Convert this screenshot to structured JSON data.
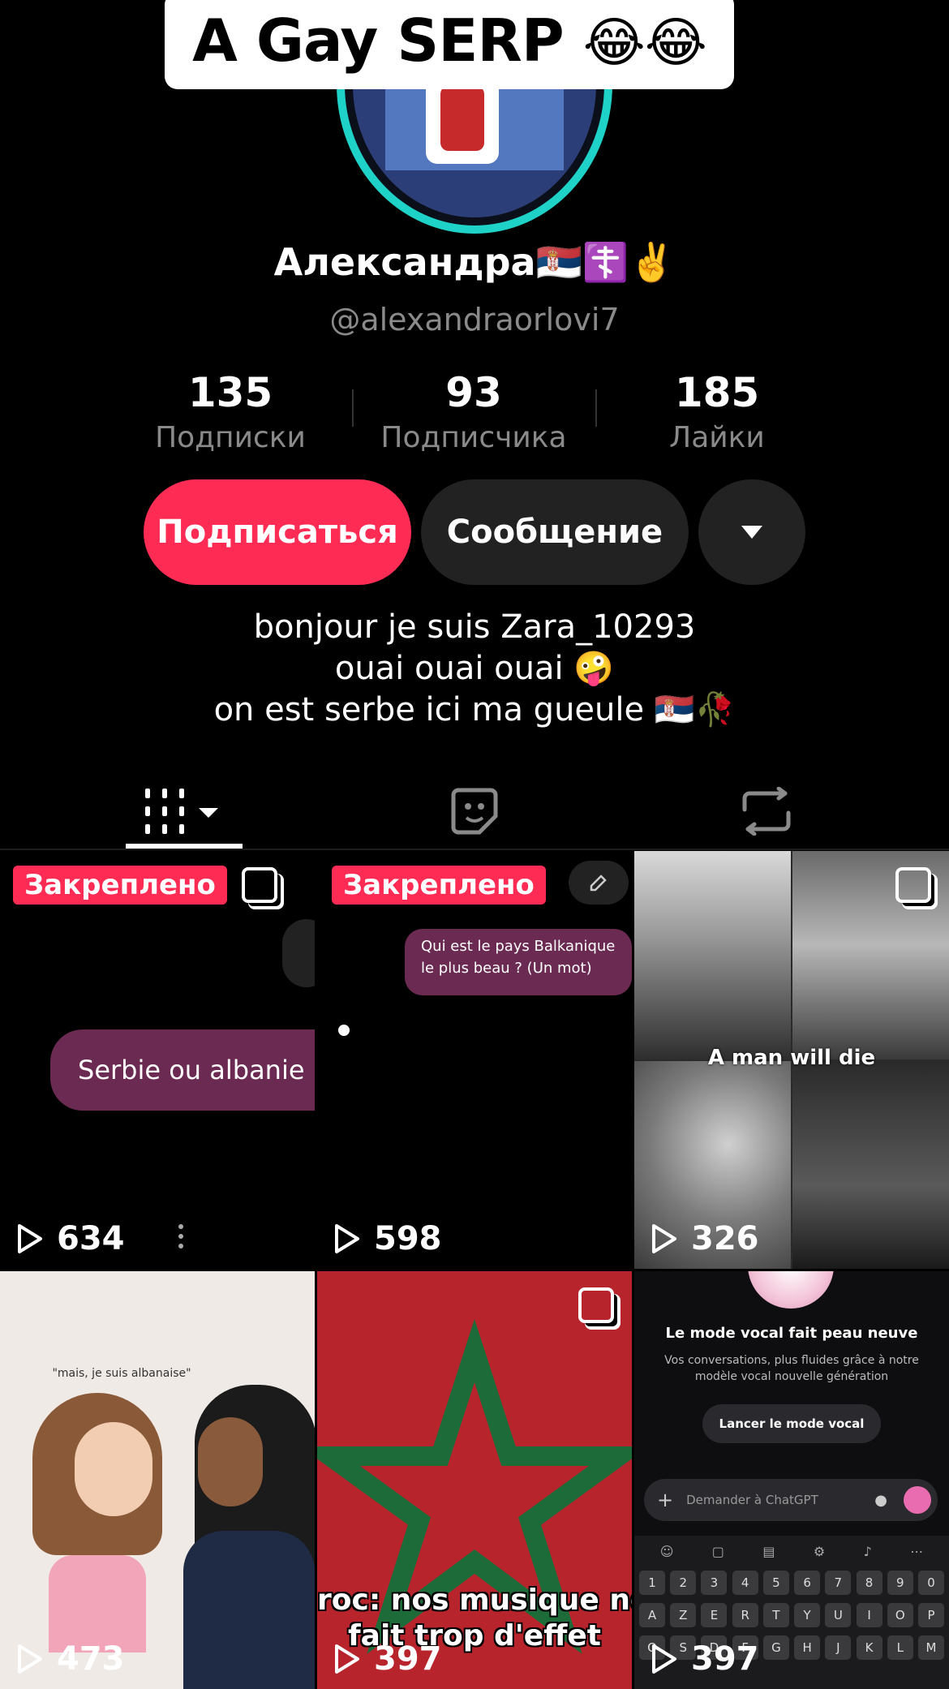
{
  "caption": {
    "text": "A Gay SERP",
    "emoji": "😂😂"
  },
  "profile": {
    "name": "Александра🇷🇸☦️✌️",
    "handle": "@alexandraorlovi7"
  },
  "stats": [
    {
      "value": "135",
      "label": "Подписки"
    },
    {
      "value": "93",
      "label": "Подписчика"
    },
    {
      "value": "185",
      "label": "Лайки"
    }
  ],
  "actions": {
    "follow": "Подписаться",
    "message": "Сообщение"
  },
  "bio": [
    "bonjour je suis Zara_10293",
    "ouai ouai ouai 🤪",
    "on est serbe ici ma gueule 🇷🇸🥀"
  ],
  "tabs": [
    "videos-grid",
    "liked-sticker",
    "reposts"
  ],
  "videos": [
    {
      "views": "634",
      "pinned_label": "Закреплено",
      "bubble": "Serbie ou albanie (u"
    },
    {
      "views": "598",
      "pinned_label": "Закреплено",
      "bubble": "Qui est le pays Balkanique le plus beau ? (Un mot)"
    },
    {
      "views": "326",
      "overlay": "A man will die"
    },
    {
      "views": "473",
      "overlay": "\"mais, je suis albanaise\""
    },
    {
      "views": "397",
      "overlay_line1": "roc: nos musique no",
      "overlay_line2": "fait trop d'effet"
    },
    {
      "views": "397",
      "title": "Le mode vocal fait peau neuve",
      "subtitle": "Vos conversations, plus fluides grâce à notre modèle vocal nouvelle génération",
      "cta": "Lancer le mode vocal",
      "input_placeholder": "Demander à ChatGPT",
      "keys_row1": [
        "1",
        "2",
        "3",
        "4",
        "5",
        "6",
        "7",
        "8",
        "9",
        "0"
      ],
      "keys_row2": [
        "A",
        "Z",
        "E",
        "R",
        "T",
        "Y",
        "U",
        "I",
        "O",
        "P"
      ],
      "keys_row3": [
        "Q",
        "S",
        "D",
        "F",
        "G",
        "H",
        "J",
        "K",
        "L",
        "M"
      ]
    }
  ],
  "colors": {
    "accent": "#fe2c55",
    "avatar_ring": "#1ed2c8"
  }
}
